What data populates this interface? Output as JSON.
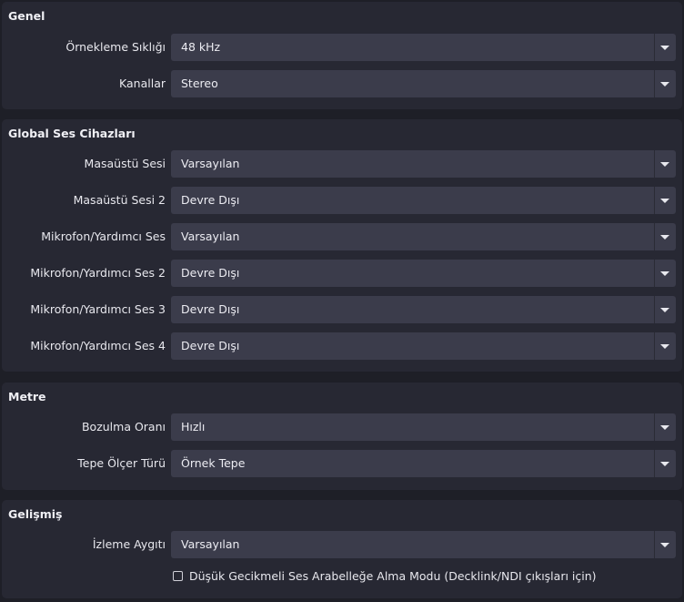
{
  "sections": {
    "general": {
      "title": "Genel",
      "sample_rate": {
        "label": "Örnekleme Sıklığı",
        "value": "48 kHz"
      },
      "channels": {
        "label": "Kanallar",
        "value": "Stereo"
      }
    },
    "global_audio": {
      "title": "Global Ses Cihazları",
      "desktop_audio": {
        "label": "Masaüstü Sesi",
        "value": "Varsayılan"
      },
      "desktop_audio_2": {
        "label": "Masaüstü Sesi 2",
        "value": "Devre Dışı"
      },
      "mic_aux": {
        "label": "Mikrofon/Yardımcı Ses",
        "value": "Varsayılan"
      },
      "mic_aux_2": {
        "label": "Mikrofon/Yardımcı Ses 2",
        "value": "Devre Dışı"
      },
      "mic_aux_3": {
        "label": "Mikrofon/Yardımcı Ses 3",
        "value": "Devre Dışı"
      },
      "mic_aux_4": {
        "label": "Mikrofon/Yardımcı Ses 4",
        "value": "Devre Dışı"
      }
    },
    "meters": {
      "title": "Metre",
      "decay_rate": {
        "label": "Bozulma Oranı",
        "value": "Hızlı"
      },
      "peak_meter_type": {
        "label": "Tepe Ölçer Türü",
        "value": "Örnek Tepe"
      }
    },
    "advanced": {
      "title": "Gelişmiş",
      "monitoring_device": {
        "label": "İzleme Aygıtı",
        "value": "Varsayılan"
      },
      "low_latency": {
        "label": "Düşük Gecikmeli Ses Arabelleğe Alma Modu (Decklink/NDI çıkışları için)",
        "checked": false
      }
    }
  },
  "icons": {
    "dropdown": "chevron-down-icon",
    "checkbox": "checkbox-unchecked-icon"
  },
  "colors": {
    "background": "#1e1f27",
    "panel": "#272833",
    "field": "#3b3c4b",
    "text": "#e8e8ee"
  }
}
